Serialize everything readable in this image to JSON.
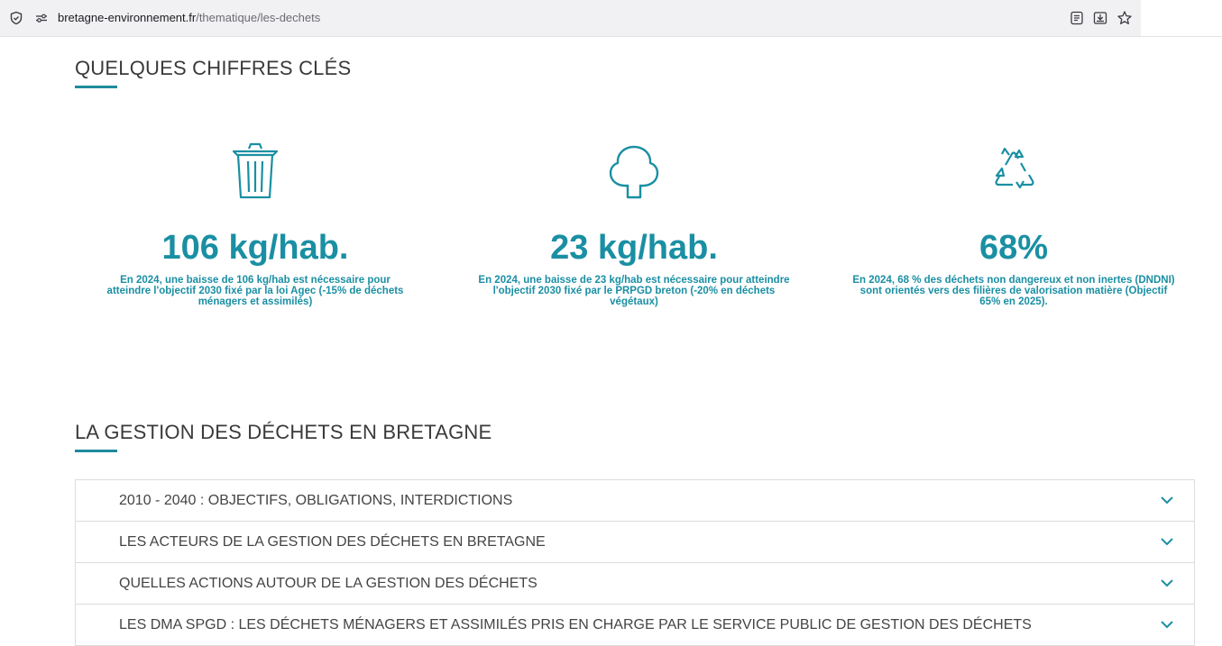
{
  "browser": {
    "url_domain": "bretagne-environnement.fr",
    "url_path": "/thematique/les-dechets",
    "left_icons": [
      "shield-icon",
      "permissions-icon"
    ],
    "right_icons": [
      "reader-view-icon",
      "save-to-pocket-icon",
      "bookmark-star-icon"
    ]
  },
  "key_figures": {
    "title": "QUELQUES CHIFFRES CLÉS",
    "items": [
      {
        "icon": "trash-bin-icon",
        "value": "106 kg/hab.",
        "description": "En 2024, une baisse de 106 kg/hab est nécessaire pour atteindre l'objectif 2030 fixé par la loi Agec (-15% de déchets ménagers et assimilés)"
      },
      {
        "icon": "tree-icon",
        "value": "23 kg/hab.",
        "description": "En 2024, une baisse de 23 kg/hab est nécessaire pour atteindre l'objectif 2030 fixé par le PRPGD breton (-20% en déchets végétaux)"
      },
      {
        "icon": "recycle-icon",
        "value": "68%",
        "description": "En 2024, 68 % des déchets non dangereux et non inertes (DNDNI) sont orientés vers des filières de valorisation matière (Objectif 65% en 2025)."
      }
    ]
  },
  "management": {
    "title": "LA GESTION DES DÉCHETS EN BRETAGNE",
    "accordion": [
      "2010 - 2040 : OBJECTIFS, OBLIGATIONS, INTERDICTIONS",
      "LES ACTEURS DE LA GESTION DES DÉCHETS EN BRETAGNE",
      "QUELLES ACTIONS AUTOUR DE LA GESTION DES DÉCHETS",
      "LES DMA SPGD : LES DÉCHETS MÉNAGERS ET ASSIMILÉS PRIS EN CHARGE PAR LE SERVICE PUBLIC DE GESTION DES DÉCHETS"
    ]
  },
  "colors": {
    "accent": "#1a8fa3",
    "underline": "#1f8a9c",
    "heading": "#3a3a3a",
    "chevron": "#1a8fa3"
  }
}
